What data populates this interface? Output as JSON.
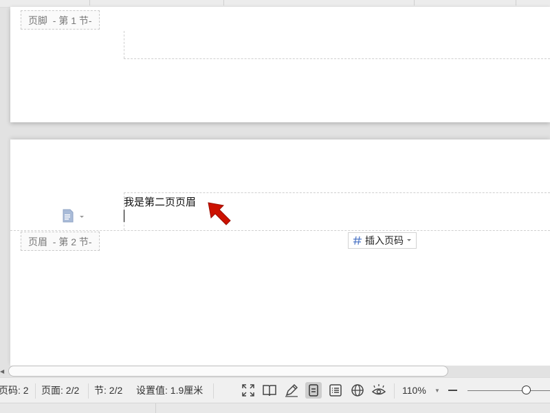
{
  "page1": {
    "footer_tag": "页脚  - 第 1 节-"
  },
  "page2": {
    "header_tag": "页眉  - 第 2 节-",
    "header_text": "我是第二页页眉",
    "insert_page_number_button": {
      "label": "插入页码",
      "icon": "hash-icon"
    }
  },
  "statusbar": {
    "page_number": "页码: 2",
    "page_count": "页面: 2/2",
    "section": "节: 2/2",
    "setting_value": "设置值: 1.9厘米",
    "view_icons": [
      "fullscreen-icon",
      "reading-mode-icon",
      "pen-icon",
      "page-view-icon",
      "outline-view-icon",
      "web-view-icon",
      "eye-protection-icon"
    ],
    "active_view": "page-view-icon",
    "zoom": "110%",
    "zoom_level_percent": 110
  },
  "colors": {
    "annotation_arrow": "#cc1100",
    "workspace_bg": "#e2e2e2",
    "statusbar_bg": "#f0f0f0"
  }
}
